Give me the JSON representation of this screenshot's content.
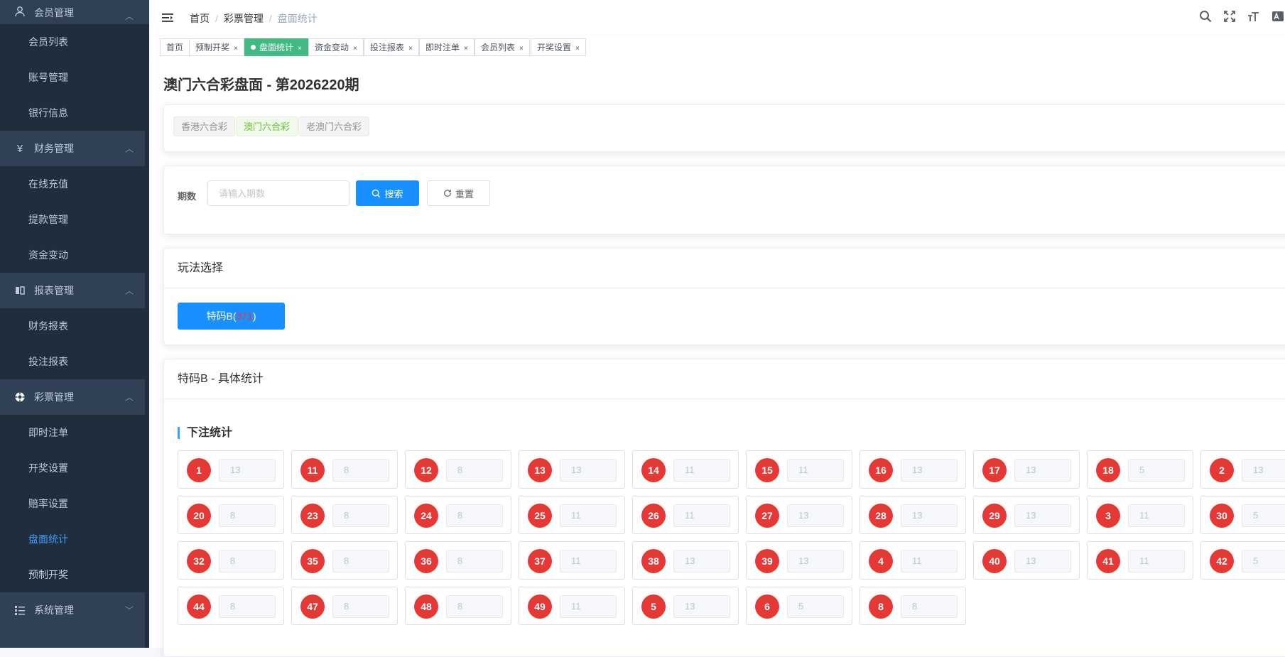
{
  "sidebar": {
    "groups": [
      {
        "label": "会员管理",
        "icon": "user-icon",
        "items": [
          "会员列表",
          "账号管理",
          "银行信息"
        ]
      },
      {
        "label": "财务管理",
        "icon": "yen-icon",
        "items": [
          "在线充值",
          "提款管理",
          "资金变动"
        ]
      },
      {
        "label": "报表管理",
        "icon": "book-icon",
        "items": [
          "财务报表",
          "投注报表"
        ]
      },
      {
        "label": "彩票管理",
        "icon": "lottery-icon",
        "items": [
          "即时注单",
          "开奖设置",
          "赔率设置",
          "盘面统计",
          "预制开奖"
        ]
      },
      {
        "label": "系统管理",
        "icon": "list-icon",
        "items": []
      }
    ],
    "active_item": "盘面统计"
  },
  "header": {
    "breadcrumb": [
      "首页",
      "彩票管理",
      "盘面统计"
    ]
  },
  "tags": [
    {
      "label": "首页",
      "closable": false,
      "active": false
    },
    {
      "label": "预制开奖",
      "closable": true,
      "active": false
    },
    {
      "label": "盘面统计",
      "closable": true,
      "active": true
    },
    {
      "label": "资金变动",
      "closable": true,
      "active": false
    },
    {
      "label": "投注报表",
      "closable": true,
      "active": false
    },
    {
      "label": "即时注单",
      "closable": true,
      "active": false
    },
    {
      "label": "会员列表",
      "closable": true,
      "active": false
    },
    {
      "label": "开奖设置",
      "closable": true,
      "active": false
    }
  ],
  "page": {
    "title": "澳门六合彩盘面 - 第2026220期",
    "lottery_types": [
      "香港六合彩",
      "澳门六合彩",
      "老澳门六合彩"
    ],
    "active_lottery": "澳门六合彩"
  },
  "search": {
    "label": "期数",
    "placeholder": "请输入期数",
    "search_label": "搜索",
    "reset_label": "重置"
  },
  "play": {
    "header": "玩法选择",
    "button_prefix": "特码B(",
    "button_count": "371",
    "button_suffix": ")"
  },
  "stats": {
    "header": "特码B - 具体统计",
    "section_title": "下注统计",
    "entries": [
      {
        "num": "1",
        "count": "13"
      },
      {
        "num": "11",
        "count": "8"
      },
      {
        "num": "12",
        "count": "8"
      },
      {
        "num": "13",
        "count": "13"
      },
      {
        "num": "14",
        "count": "11"
      },
      {
        "num": "15",
        "count": "11"
      },
      {
        "num": "16",
        "count": "13"
      },
      {
        "num": "17",
        "count": "13"
      },
      {
        "num": "18",
        "count": "5"
      },
      {
        "num": "2",
        "count": "13"
      },
      {
        "num": "20",
        "count": "8"
      },
      {
        "num": "23",
        "count": "8"
      },
      {
        "num": "24",
        "count": "8"
      },
      {
        "num": "25",
        "count": "11"
      },
      {
        "num": "26",
        "count": "11"
      },
      {
        "num": "27",
        "count": "13"
      },
      {
        "num": "28",
        "count": "13"
      },
      {
        "num": "29",
        "count": "13"
      },
      {
        "num": "3",
        "count": "11"
      },
      {
        "num": "30",
        "count": "5"
      },
      {
        "num": "32",
        "count": "8"
      },
      {
        "num": "35",
        "count": "8"
      },
      {
        "num": "36",
        "count": "8"
      },
      {
        "num": "37",
        "count": "11"
      },
      {
        "num": "38",
        "count": "13"
      },
      {
        "num": "39",
        "count": "13"
      },
      {
        "num": "4",
        "count": "11"
      },
      {
        "num": "40",
        "count": "13"
      },
      {
        "num": "41",
        "count": "11"
      },
      {
        "num": "42",
        "count": "5"
      },
      {
        "num": "44",
        "count": "8"
      },
      {
        "num": "47",
        "count": "8"
      },
      {
        "num": "48",
        "count": "8"
      },
      {
        "num": "49",
        "count": "11"
      },
      {
        "num": "5",
        "count": "13"
      },
      {
        "num": "6",
        "count": "5"
      },
      {
        "num": "8",
        "count": "8"
      }
    ]
  },
  "colors": {
    "sidebar_bg": "#304156",
    "submenu_bg": "#1f2d3d",
    "primary": "#1890ff",
    "active_tag": "#42b983",
    "ball": "#e53935"
  }
}
